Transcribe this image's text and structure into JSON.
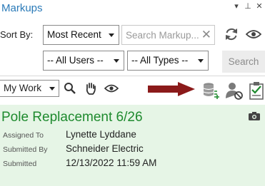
{
  "window": {
    "title": "Markups",
    "menu_glyph": "▾",
    "pin_glyph": "⊥",
    "close_glyph": "✕"
  },
  "filters": {
    "sort_label": "Sort By:",
    "sort_value": "Most Recent",
    "search_placeholder": "Search Markup...",
    "users_value": "-- All Users --",
    "types_value": "-- All Types --",
    "search_button": "Search"
  },
  "toolbar": {
    "scope_value": "My Work"
  },
  "markup": {
    "title": "Pole Replacement 6/26",
    "assigned_to_label": "Assigned To",
    "assigned_to_value": "Lynette Lyddane",
    "submitted_by_label": "Submitted By",
    "submitted_by_value": "Schneider Electric",
    "submitted_label": "Submitted",
    "submitted_value": "12/13/2022 11:59 AM"
  },
  "colors": {
    "title_blue": "#2a7ab8",
    "card_green_bg": "#e6f5e6",
    "card_title_green": "#1e8a2e",
    "arrow_red": "#8b1a1a"
  }
}
